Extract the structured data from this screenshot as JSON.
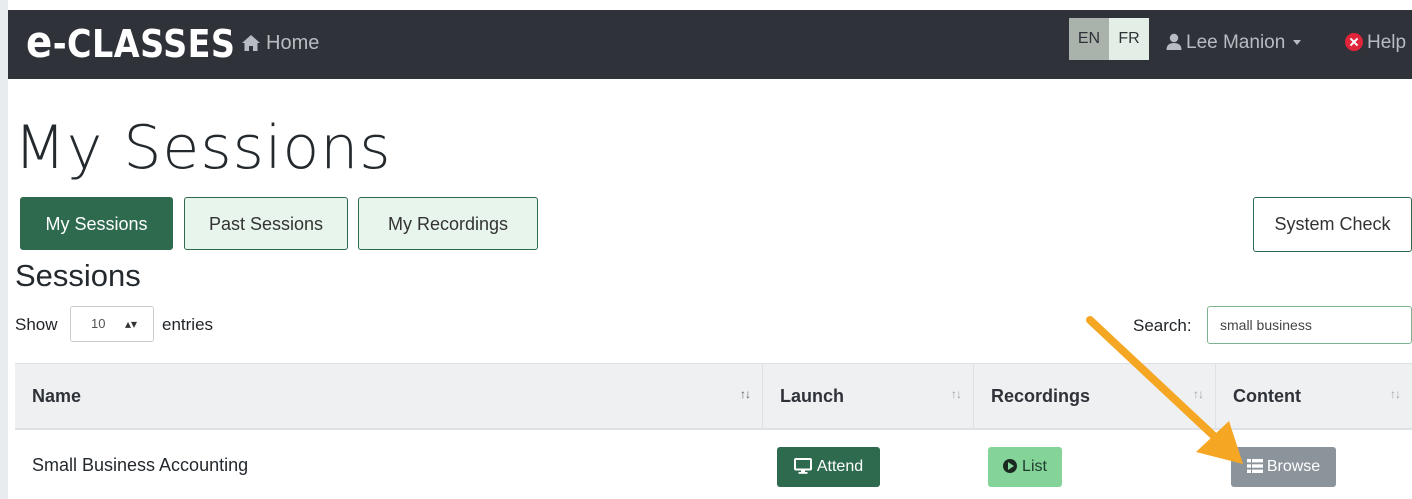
{
  "navbar": {
    "brand_e": "e",
    "brand_rest": "-CLASSES",
    "home_label": "Home",
    "lang_en": "EN",
    "lang_fr": "FR",
    "user_name": "Lee Manion",
    "help_label": "Help",
    "background": "#2f3339"
  },
  "page": {
    "title": "My Sessions",
    "tabs": [
      {
        "label": "My Sessions",
        "active": true
      },
      {
        "label": "Past Sessions",
        "active": false
      },
      {
        "label": "My Recordings",
        "active": false
      }
    ],
    "system_check_label": "System Check",
    "section_heading": "Sessions"
  },
  "table_controls": {
    "show_label": "Show",
    "entries_value": "10",
    "entries_label": "entries",
    "search_label": "Search:",
    "search_value": "small business"
  },
  "table": {
    "columns": [
      "Name",
      "Launch",
      "Recordings",
      "Content"
    ],
    "rows": [
      {
        "name": "Small Business Accounting",
        "launch_label": "Attend",
        "recordings_label": "List",
        "content_label": "Browse"
      }
    ]
  },
  "icons": {
    "home": "home-icon",
    "user": "user-icon",
    "help": "help-icon",
    "sort": "sort-icon",
    "monitor": "monitor-icon",
    "play": "play-circle-icon",
    "list": "list-icon",
    "arrow": "annotation-arrow-icon"
  },
  "colors": {
    "primary_green": "#2e6a4e",
    "light_green": "#84d49a",
    "tab_bg": "#e8f5ec",
    "browse_gray": "#8c949b",
    "annotation_orange": "#f5a623"
  }
}
